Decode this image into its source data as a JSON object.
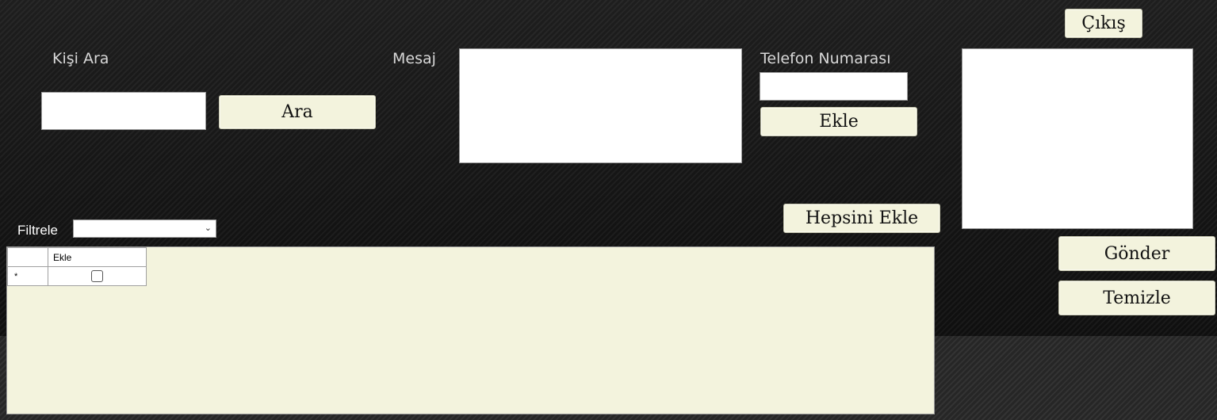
{
  "search": {
    "label": "Kişi Ara",
    "input_value": "",
    "button_label": "Ara"
  },
  "message": {
    "label": "Mesaj",
    "value": ""
  },
  "phone": {
    "label": "Telefon Numarası",
    "input_value": "",
    "add_label": "Ekle"
  },
  "exit_label": "Çıkış",
  "add_all_label": "Hepsini Ekle",
  "numbers_list_value": "",
  "send_label": "Gönder",
  "clear_label": "Temizle",
  "filter": {
    "label": "Filtrele",
    "selected": ""
  },
  "grid": {
    "columns": [
      "",
      "Ekle"
    ],
    "new_row_marker": "*"
  }
}
